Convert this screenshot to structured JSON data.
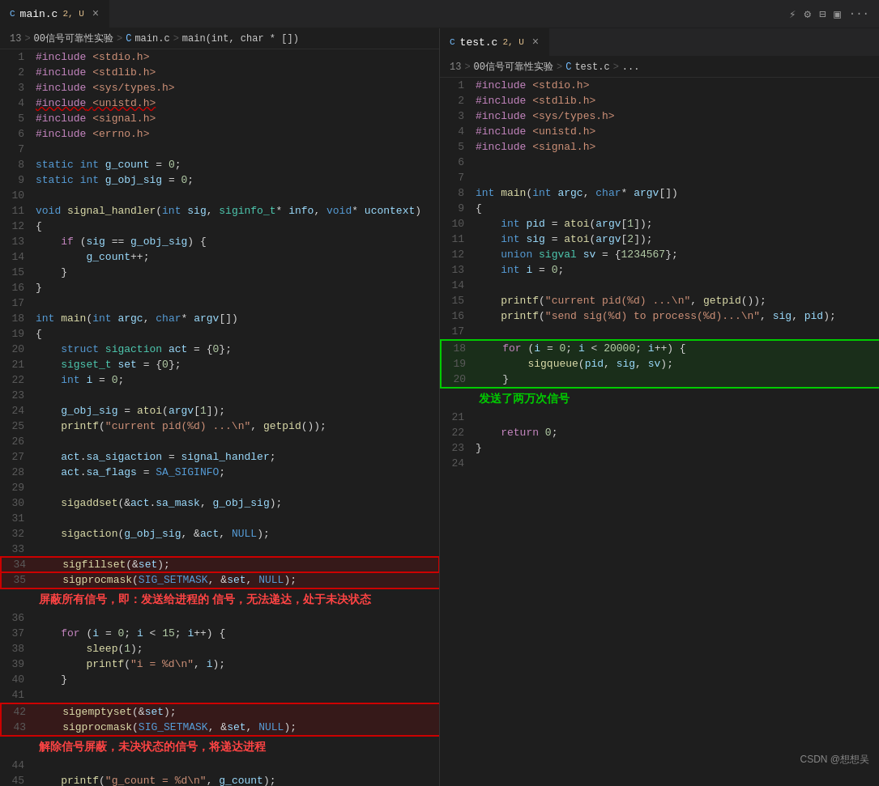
{
  "tabs": {
    "left": {
      "name": "main.c",
      "modified": "2, U",
      "active": true,
      "close_label": "×"
    },
    "right": {
      "name": "test.c",
      "modified": "2, U",
      "active": true,
      "close_label": "×"
    }
  },
  "toolbar": {
    "run_icon": "▷",
    "settings_icon": "⚙",
    "split_icon": "⊞",
    "layout_icon": "▣",
    "more_icon": "···"
  },
  "left_breadcrumb": {
    "num": "13",
    "path": "00信号可靠性实验",
    "lang": "C",
    "file": "main.c",
    "func": "main(int, char * [])"
  },
  "right_breadcrumb": {
    "num": "13",
    "path": "00信号可靠性实验",
    "lang": "C",
    "file": "test.c",
    "more": "..."
  },
  "annotations": {
    "shield_annotation": "屏蔽所有信号，即：发送给进程的\n信号，无法递达，处于未决状态",
    "unblock_annotation": "解除信号屏蔽，未决状态的信号，将递达进程",
    "send_annotation": "发送了两万次信号"
  },
  "watermark": "CSDN @想想吴"
}
